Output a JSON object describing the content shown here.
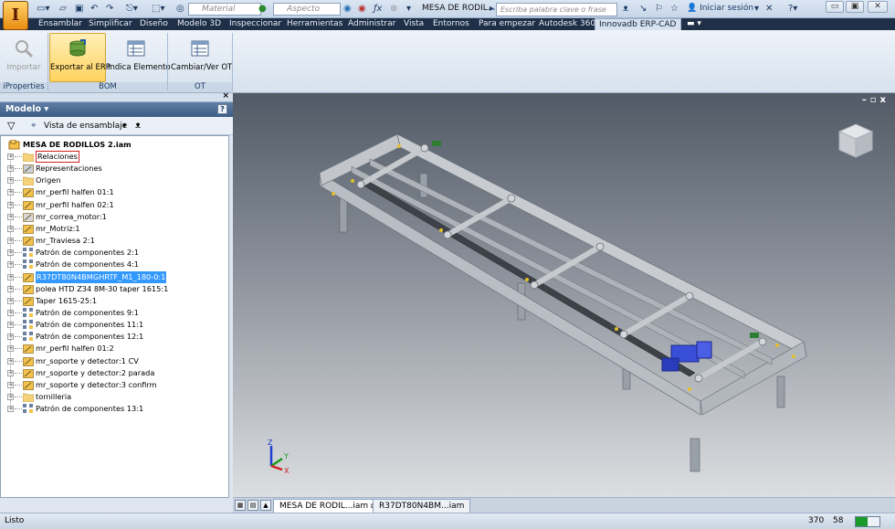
{
  "app": {
    "logo_letter": "I",
    "document_title": "MESA DE RODIL...",
    "search_placeholder": "Escriba palabra clave o frase",
    "sign_in": "Iniciar sesión",
    "qat_material": "Material",
    "qat_appearance": "Aspecto"
  },
  "ribbon_tabs": [
    "Ensamblar",
    "Simplificar",
    "Diseño",
    "Modelo 3D",
    "Inspeccionar",
    "Herramientas",
    "Administrar",
    "Vista",
    "Entornos",
    "Para empezar",
    "Autodesk 360",
    "Innovadb ERP-CAD"
  ],
  "ribbon": {
    "buttons": [
      {
        "label": "Importar",
        "icon": "import-icon",
        "disabled": true
      },
      {
        "label": "Exportar al ERP",
        "icon": "export-erp-icon",
        "selected": true
      },
      {
        "label": "Indica Elemento",
        "icon": "indicate-element-icon"
      },
      {
        "label": "Cambiar/Ver OT",
        "icon": "change-ot-icon"
      }
    ],
    "groups": [
      "iProperties",
      "BOM",
      "OT"
    ]
  },
  "model_panel": {
    "title": "Modelo",
    "view_mode": "Vista de ensamblaje",
    "root": "MESA DE RODILLOS 2.iam",
    "nodes": [
      {
        "label": "Relaciones",
        "icon": "folder-icon"
      },
      {
        "label": "Representaciones",
        "icon": "representations-icon"
      },
      {
        "label": "Origen",
        "icon": "folder-icon"
      },
      {
        "label": "mr_perfil halfen 01:1",
        "icon": "subassembly-icon"
      },
      {
        "label": "mr_perfil halfen 02:1",
        "icon": "subassembly-icon"
      },
      {
        "label": "mr_correa_motor:1",
        "icon": "belt-icon"
      },
      {
        "label": "mr_Motriz:1",
        "icon": "subassembly-icon"
      },
      {
        "label": "mr_Traviesa 2:1",
        "icon": "assembly-icon"
      },
      {
        "label": "Patrón de componentes 2:1",
        "icon": "pattern-icon"
      },
      {
        "label": "Patrón de componentes 4:1",
        "icon": "pattern-icon"
      },
      {
        "label": "R37DT80N4BMGHRTF_M1_180-0:1",
        "icon": "assembly-icon",
        "selected": true
      },
      {
        "label": "polea HTD Z34 8M-30 taper 1615:1",
        "icon": "part-icon"
      },
      {
        "label": "Taper 1615-25:1",
        "icon": "assembly-icon"
      },
      {
        "label": "Patrón de componentes 9:1",
        "icon": "pattern-icon"
      },
      {
        "label": "Patrón de componentes 11:1",
        "icon": "pattern-icon"
      },
      {
        "label": "Patrón de componentes 12:1",
        "icon": "pattern-icon"
      },
      {
        "label": "mr_perfil halfen 01:2",
        "icon": "part-icon"
      },
      {
        "label": "mr_soporte y detector:1 CV",
        "icon": "subassembly-icon"
      },
      {
        "label": "mr_soporte y detector:2 parada",
        "icon": "assembly-icon"
      },
      {
        "label": "mr_soporte y detector:3 confirm",
        "icon": "assembly-icon"
      },
      {
        "label": "tornilleria",
        "icon": "folder-icon"
      },
      {
        "label": "Patrón de componentes 13:1",
        "icon": "pattern-icon"
      }
    ]
  },
  "viewport": {
    "triad_axes": [
      "Z",
      "Y",
      "X"
    ]
  },
  "document_tabs": [
    "MESA DE RODIL...iam",
    "R37DT80N4BM...iam"
  ],
  "status": {
    "text": "Listo",
    "num1": "370",
    "num2": "58"
  },
  "colors": {
    "selection": "#3399ff",
    "ribbon_tab_bar": "#1f2f47",
    "motor": "#3a4fd8",
    "frame": "#b8bcc2"
  }
}
